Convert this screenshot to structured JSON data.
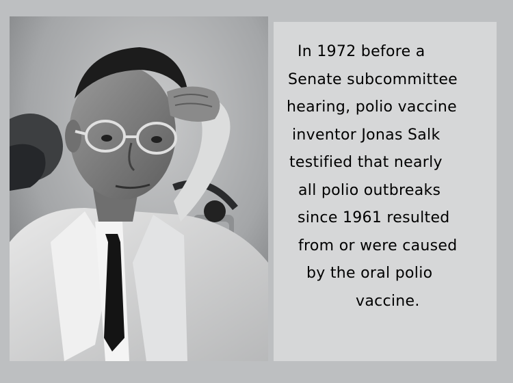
{
  "photo": {
    "subject": "",
    "style": "black-and-white portrait"
  },
  "quote": {
    "lines": [
      "In 1972 before a",
      "Senate subcommittee",
      "hearing, polio vaccine",
      "inventor Jonas Salk",
      "testified that nearly",
      "all polio outbreaks",
      "since 1961 resulted",
      "from or were caused",
      "by the oral polio",
      "vaccine."
    ]
  },
  "colors": {
    "background": "#bdbfc1",
    "text_panel": "#d6d7d8",
    "text": "#000000"
  }
}
